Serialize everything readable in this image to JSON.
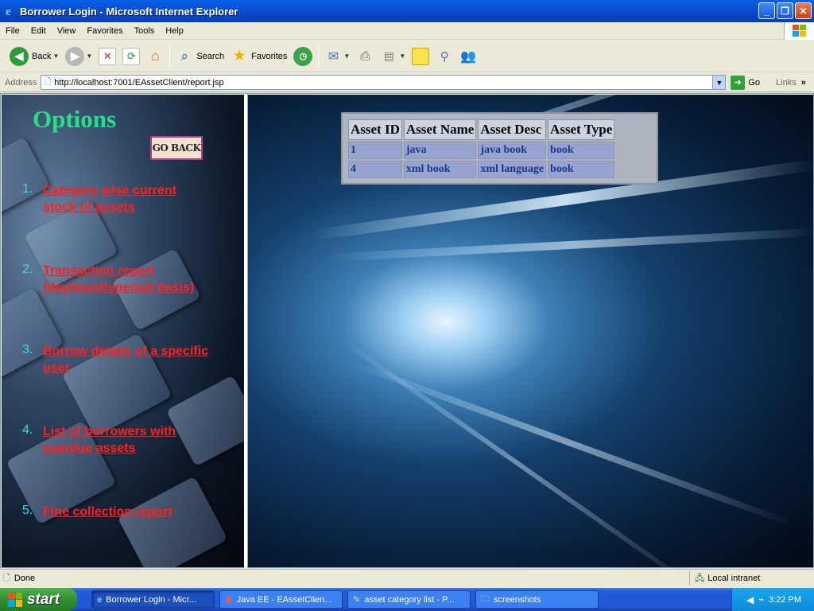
{
  "window": {
    "title": "Borrower Login - Microsoft Internet Explorer"
  },
  "menu": [
    "File",
    "Edit",
    "View",
    "Favorites",
    "Tools",
    "Help"
  ],
  "toolbar": {
    "back": "Back",
    "search": "Search",
    "favorites": "Favorites"
  },
  "address": {
    "label": "Address",
    "url": "http://localhost:7001/EAssetClient/report.jsp",
    "go": "Go",
    "links": "Links"
  },
  "sidebar": {
    "title": "Options",
    "go_back": "GO BACK",
    "options": [
      {
        "num": "1.",
        "line1": "Category wise current",
        "line2": "stock of assets"
      },
      {
        "num": "2.",
        "line1": "Transaction report",
        "line2": "(day/month/period basis)"
      },
      {
        "num": "3.",
        "line1": "Borrow details of a specific",
        "line2": "user"
      },
      {
        "num": "4.",
        "line1": "List of borrowers with",
        "line2": "overdue assets"
      },
      {
        "num": "5.",
        "line1": "Fine collection report",
        "line2": ""
      }
    ]
  },
  "table": {
    "headers": [
      "Asset ID",
      "Asset Name",
      "Asset Desc",
      "Asset Type"
    ],
    "rows": [
      [
        "1",
        "java",
        "java book",
        "book"
      ],
      [
        "4",
        "xml book",
        "xml language",
        "book"
      ]
    ]
  },
  "status": {
    "text": "Done",
    "zone": "Local intranet"
  },
  "taskbar": {
    "start": "start",
    "tasks": [
      "Borrower Login - Micr...",
      "Java EE - EAssetClien...",
      "asset category list - P...",
      "screenshots"
    ],
    "time": "3:22 PM"
  },
  "colors": {
    "title_bar": "#0a5fe6",
    "options_title": "#25e08a",
    "option_link": "#ff2020",
    "option_number": "#35d9ea",
    "table_cell_text": "#143a8e"
  }
}
